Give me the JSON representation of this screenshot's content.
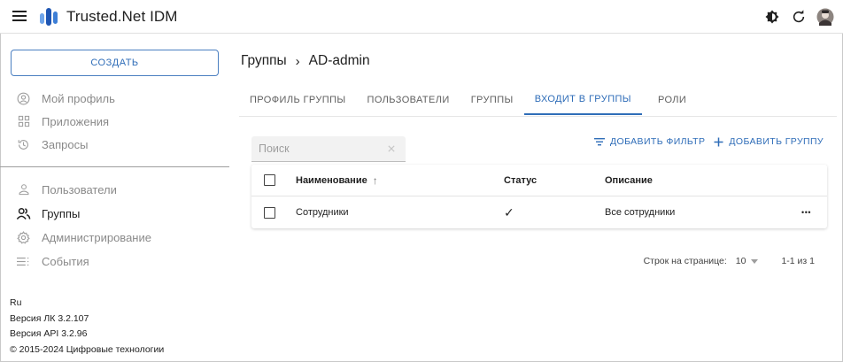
{
  "app": {
    "title": "Trusted.Net IDM"
  },
  "header": {
    "icons": [
      "menu-icon",
      "logo-icon",
      "theme-toggle-icon",
      "refresh-icon",
      "avatar"
    ]
  },
  "sidebar": {
    "create_label": "СОЗДАТЬ",
    "items_top": [
      {
        "label": "Мой профиль",
        "icon": "account-circle-icon"
      },
      {
        "label": "Приложения",
        "icon": "apps-grid-icon"
      },
      {
        "label": "Запросы",
        "icon": "history-icon"
      }
    ],
    "items_bottom": [
      {
        "label": "Пользователи",
        "icon": "person-icon"
      },
      {
        "label": "Группы",
        "icon": "group-icon",
        "active": true
      },
      {
        "label": "Администрирование",
        "icon": "settings-icon"
      },
      {
        "label": "События",
        "icon": "events-list-icon"
      }
    ],
    "footer": {
      "lang": "Ru",
      "version_lk": "Версия ЛК 3.2.107",
      "version_api": "Версия API 3.2.96",
      "copyright": "© 2015-2024 Цифровые технологии"
    }
  },
  "breadcrumb": {
    "parent": "Группы",
    "separator": "›",
    "current": "AD-admin"
  },
  "tabs": [
    {
      "label": "ПРОФИЛЬ ГРУППЫ"
    },
    {
      "label": "ПОЛЬЗОВАТЕЛИ"
    },
    {
      "label": "ГРУППЫ"
    },
    {
      "label": "ВХОДИТ В ГРУППЫ",
      "active": true
    },
    {
      "label": "РОЛИ"
    }
  ],
  "toolbar": {
    "search_placeholder": "Поиск",
    "search_value": "",
    "add_filter_label": "ДОБАВИТЬ ФИЛЬТР",
    "add_group_label": "ДОБАВИТЬ ГРУППУ"
  },
  "table": {
    "columns": {
      "name": "Наименование",
      "sort_indicator": "↑",
      "status": "Статус",
      "description": "Описание"
    },
    "rows": [
      {
        "name": "Сотрудники",
        "status": "✓",
        "description": "Все сотрудники",
        "more": "•••"
      }
    ]
  },
  "pagination": {
    "rows_per_page_label": "Строк на странице:",
    "rows_per_page_value": "10",
    "range": "1-1 из 1"
  },
  "colors": {
    "accent": "#2f6db8",
    "logo_dark": "#1f56b3",
    "logo_light": "#6fa5ea"
  }
}
